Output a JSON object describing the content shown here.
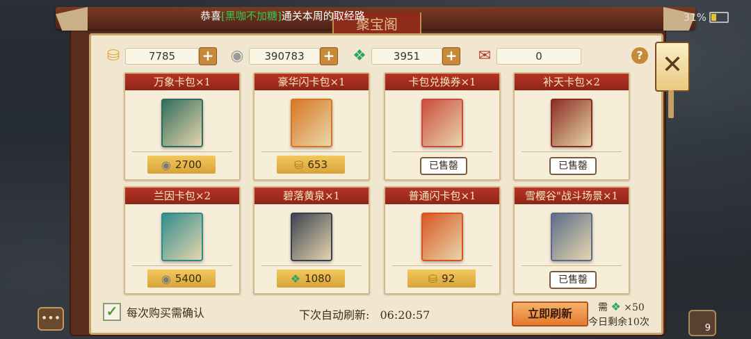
{
  "title": "聚宝阁",
  "marquee": {
    "prefix": "恭喜",
    "player": "[黑咖不加糖]",
    "suffix": "通关本周的取经路"
  },
  "status": {
    "battery": "31%"
  },
  "resources": [
    {
      "icon": "gold-ingot-icon",
      "value": "7785",
      "has_plus": true
    },
    {
      "icon": "silver-coin-icon",
      "value": "390783",
      "has_plus": true
    },
    {
      "icon": "jade-icon",
      "value": "3951",
      "has_plus": true
    },
    {
      "icon": "scroll-icon",
      "value": "0",
      "has_plus": false
    }
  ],
  "help_label": "?",
  "close_label": "✕",
  "items": [
    {
      "title": "万象卡包×1",
      "art_color": "#2f6a5a",
      "price": "2700",
      "currency": "silver-coin-icon",
      "sold": false
    },
    {
      "title": "豪华闪卡包×1",
      "art_color": "#d8751e",
      "price": "653",
      "currency": "gold-ingot-icon",
      "sold": false
    },
    {
      "title": "卡包兑换券×1",
      "art_color": "#c94a3a",
      "price": "",
      "currency": "",
      "sold": true
    },
    {
      "title": "补天卡包×2",
      "art_color": "#8a2a1e",
      "price": "",
      "currency": "",
      "sold": true
    },
    {
      "title": "兰因卡包×2",
      "art_color": "#2f8a8a",
      "price": "5400",
      "currency": "silver-coin-icon",
      "sold": false
    },
    {
      "title": "碧落黄泉×1",
      "art_color": "#3a4050",
      "price": "1080",
      "currency": "jade-icon",
      "sold": false
    },
    {
      "title": "普通闪卡包×1",
      "art_color": "#d8531e",
      "price": "92",
      "currency": "gold-ingot-icon",
      "sold": false
    },
    {
      "title": "雪樱谷\"战斗场景×1",
      "art_color": "#5a6a88",
      "price": "",
      "currency": "",
      "sold": true
    }
  ],
  "sold_label": "已售罄",
  "footer": {
    "confirm_label": "每次购买需确认",
    "refresh_prefix": "下次自动刷新:",
    "refresh_time": "06:20:57",
    "refresh_button": "立即刷新",
    "need_label": "需",
    "need_cost": "×50",
    "remaining": "今日剩余10次",
    "bag_count": "9"
  },
  "colors": {
    "accent_red": "#b73426",
    "gold": "#f2c85b",
    "jade": "#2aa36b"
  }
}
